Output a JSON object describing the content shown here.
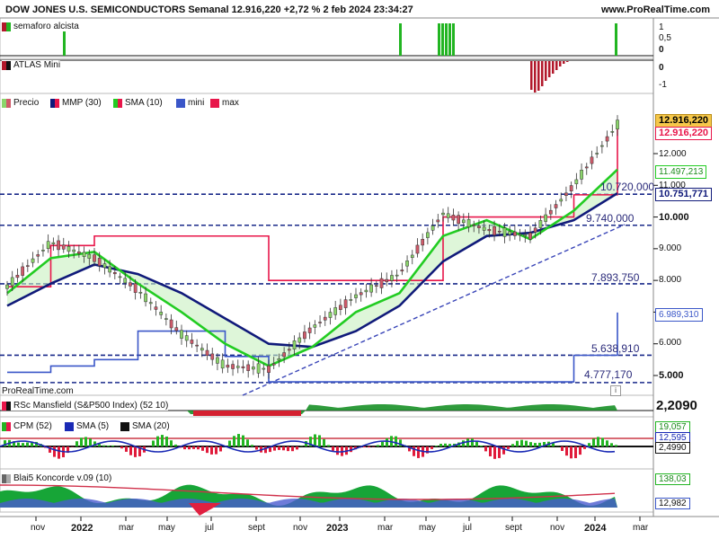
{
  "header": {
    "title": "DOW JONES U.S. SEMICONDUCTORS Semanal 12.916,220 +2,72 % 2 feb 2024 23:34:27",
    "site": "www.ProRealTime.com"
  },
  "panels": {
    "semaforo": {
      "label": "semaforo alcista",
      "ticks": [
        "1",
        "0,5",
        "0"
      ]
    },
    "atlas": {
      "label": "ATLAS Mini",
      "ticks": [
        "0",
        "-1"
      ]
    },
    "price": {
      "legend": [
        "Precio",
        "MMP (30)",
        "SMA (10)",
        "mini",
        "max"
      ],
      "ticks": [
        "12.000",
        "11.000",
        "10.000",
        "9.000",
        "8.000",
        "7.000",
        "6.000",
        "5.000"
      ],
      "price_box_1": "12.916,220",
      "price_box_2": "12.916,220",
      "sma_box": "11.497,213",
      "support_box": "10.751,771",
      "mini_box": "6.989,310",
      "levels": [
        "10.720,000",
        "9.740,000",
        "7.893,750",
        "5.638,910",
        "4.777,170"
      ],
      "watermark": "ProRealTime.com"
    },
    "mansfield": {
      "label": "RSc Mansfield (S&P500 Index) (52 10)",
      "value": "2,2090"
    },
    "cpm": {
      "legend": [
        "CPM (52)",
        "SMA (5)",
        "SMA (20)"
      ],
      "values": [
        "19,057",
        "12,595",
        "2,4990"
      ]
    },
    "koncorde": {
      "label": "Blai5 Koncorde v.09 (10)",
      "values": [
        "138,03",
        "12,982"
      ]
    }
  },
  "xaxis": {
    "labels": [
      "nov",
      "2022",
      "mar",
      "may",
      "jul",
      "sept",
      "nov",
      "2023",
      "mar",
      "may",
      "jul",
      "sept",
      "nov",
      "2024",
      "mar"
    ]
  },
  "colors": {
    "up_candle": "#8bd56b",
    "down_candle": "#d05a6a",
    "sma_green": "#22cc22",
    "mmp_navy": "#101a7a",
    "max_red": "#e8164a",
    "mini_blue": "#3a56c8",
    "level_dashed": "#1a2a8a",
    "semaforo_bar": "#22b522",
    "atlas_bar": "#b2182b"
  },
  "chart_data": {
    "type": "line",
    "title": "DOW JONES U.S. SEMICONDUCTORS Semanal",
    "x": [
      "nov 2021",
      "2022",
      "mar 2022",
      "may 2022",
      "jul 2022",
      "sept 2022",
      "nov 2022",
      "2023",
      "mar 2023",
      "may 2023",
      "jul 2023",
      "sept 2023",
      "nov 2023",
      "2024",
      "feb 2024"
    ],
    "ylim": [
      4600,
      13000
    ],
    "series": [
      {
        "name": "Precio",
        "values": [
          7800,
          9200,
          8700,
          7700,
          6300,
          5300,
          5200,
          6500,
          7500,
          8200,
          10100,
          9600,
          9400,
          11000,
          12916
        ]
      },
      {
        "name": "SMA (10)",
        "values": [
          7600,
          8700,
          8900,
          7900,
          7000,
          6000,
          5300,
          5900,
          7000,
          7600,
          9400,
          9900,
          9300,
          10200,
          11497
        ]
      },
      {
        "name": "MMP (30)",
        "values": [
          7200,
          7900,
          8500,
          8200,
          7600,
          6800,
          6000,
          5900,
          6400,
          7200,
          8600,
          9400,
          9500,
          9900,
          10751
        ]
      },
      {
        "name": "max",
        "values": [
          7800,
          9100,
          9400,
          9400,
          9400,
          9400,
          8000,
          8000,
          8000,
          8000,
          10000,
          10000,
          10000,
          10700,
          12916
        ]
      },
      {
        "name": "mini",
        "values": [
          5100,
          5300,
          5500,
          6400,
          6400,
          5600,
          4800,
          4800,
          4800,
          4800,
          4800,
          4800,
          4800,
          5638,
          6989
        ]
      }
    ],
    "levels": [
      10720,
      9740,
      7893.75,
      5638.91,
      4777.17
    ]
  }
}
